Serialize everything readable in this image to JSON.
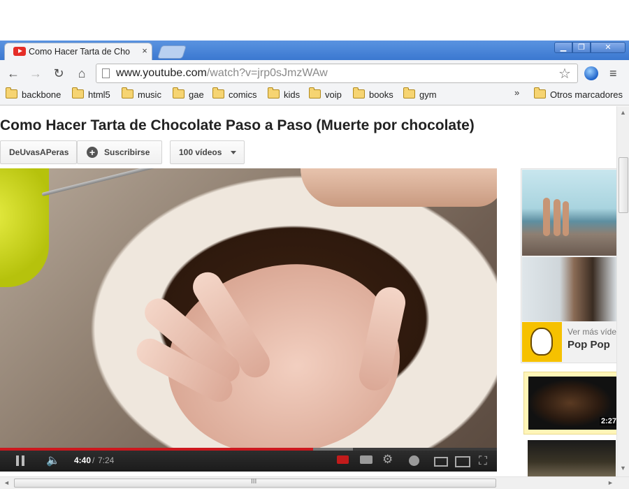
{
  "browser": {
    "tab_title": "Como Hacer Tarta de Cho",
    "tab_close": "×",
    "window_buttons": {
      "minimize": "▁",
      "maximize": "❐",
      "close": "✕"
    },
    "nav": {
      "back": "←",
      "forward": "→",
      "reload": "↻",
      "home": "⌂"
    },
    "url_host": "www.youtube.com",
    "url_path": "/watch?v=jrp0sJmzWAw",
    "star": "☆",
    "menu": "≡",
    "bookmarks": [
      "backbone",
      "html5",
      "music",
      "gae",
      "comics",
      "kids",
      "voip",
      "books",
      "gym"
    ],
    "bookmarks_overflow": "»",
    "other_bookmarks": "Otros marcadores"
  },
  "page": {
    "video_title": "Como Hacer Tarta de Chocolate Paso a Paso (Muerte por chocolate)",
    "channel_name": "DeUvasAPeras",
    "subscribe_label": "Suscribirse",
    "videos_count_label": "100 vídeos",
    "player": {
      "current_time": "4:40",
      "separator": "/",
      "total_time": "7:24",
      "progress_fraction": 0.63,
      "loaded_fraction": 0.71
    },
    "sidebar": {
      "ad_see_more": "Ver más víde",
      "ad_name": "Pop Pop",
      "rec1_duration": "2:27"
    }
  },
  "scrollbars": {
    "up": "▲",
    "down": "▼",
    "left": "◄",
    "right": "►",
    "grip": "III"
  },
  "colors": {
    "tabstrip": "#3b78d0",
    "progress": "#cc181e",
    "ad_logo": "#f6c100"
  }
}
